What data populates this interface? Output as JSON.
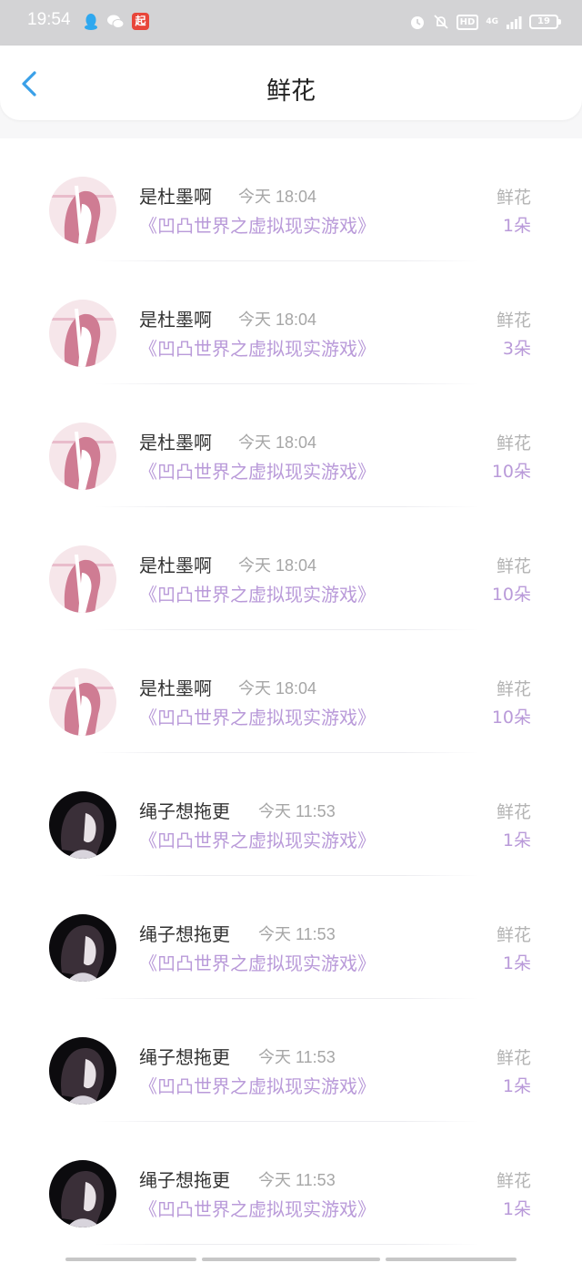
{
  "status_bar": {
    "time": "19:54",
    "app_badge": "起",
    "hd_label": "HD",
    "network_label": "4G",
    "battery_level": "19"
  },
  "header": {
    "title": "鲜花"
  },
  "records": [
    {
      "user": "是杜墨啊",
      "time": "今天 18:04",
      "book": "《凹凸世界之虚拟现实游戏》",
      "type": "鲜花",
      "count": "1朵",
      "avatar": "pink"
    },
    {
      "user": "是杜墨啊",
      "time": "今天 18:04",
      "book": "《凹凸世界之虚拟现实游戏》",
      "type": "鲜花",
      "count": "3朵",
      "avatar": "pink"
    },
    {
      "user": "是杜墨啊",
      "time": "今天 18:04",
      "book": "《凹凸世界之虚拟现实游戏》",
      "type": "鲜花",
      "count": "10朵",
      "avatar": "pink"
    },
    {
      "user": "是杜墨啊",
      "time": "今天 18:04",
      "book": "《凹凸世界之虚拟现实游戏》",
      "type": "鲜花",
      "count": "10朵",
      "avatar": "pink"
    },
    {
      "user": "是杜墨啊",
      "time": "今天 18:04",
      "book": "《凹凸世界之虚拟现实游戏》",
      "type": "鲜花",
      "count": "10朵",
      "avatar": "pink"
    },
    {
      "user": "绳子想拖更",
      "time": "今天 11:53",
      "book": "《凹凸世界之虚拟现实游戏》",
      "type": "鲜花",
      "count": "1朵",
      "avatar": "dark"
    },
    {
      "user": "绳子想拖更",
      "time": "今天 11:53",
      "book": "《凹凸世界之虚拟现实游戏》",
      "type": "鲜花",
      "count": "1朵",
      "avatar": "dark"
    },
    {
      "user": "绳子想拖更",
      "time": "今天 11:53",
      "book": "《凹凸世界之虚拟现实游戏》",
      "type": "鲜花",
      "count": "1朵",
      "avatar": "dark"
    },
    {
      "user": "绳子想拖更",
      "time": "今天 11:53",
      "book": "《凹凸世界之虚拟现实游戏》",
      "type": "鲜花",
      "count": "1朵",
      "avatar": "dark"
    }
  ],
  "colors": {
    "book_link": "#b99ad9",
    "count": "#b99ad9",
    "back_arrow": "#3aa0e8",
    "status_bar": "#d3d3d5"
  }
}
